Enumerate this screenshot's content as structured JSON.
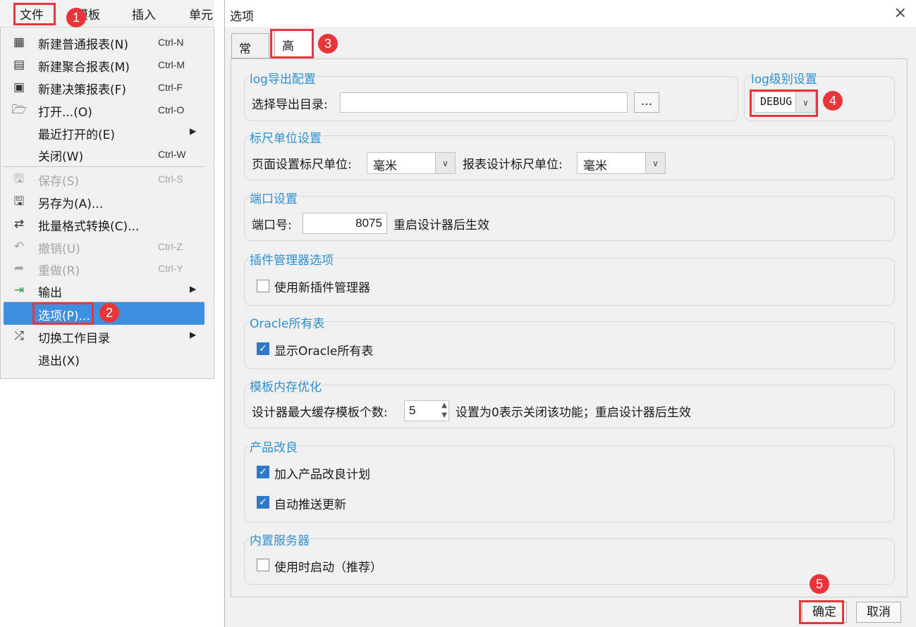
{
  "menubar": {
    "file": "文件",
    "template": "模板",
    "insert": "插入",
    "cell": "单元"
  },
  "menu": {
    "new_normal": {
      "label": "新建普通报表(N)",
      "shortcut": "Ctrl-N"
    },
    "new_aggregate": {
      "label": "新建聚合报表(M)",
      "shortcut": "Ctrl-M"
    },
    "new_decision": {
      "label": "新建决策报表(F)",
      "shortcut": "Ctrl-F"
    },
    "open": {
      "label": "打开...(O)",
      "shortcut": "Ctrl-O"
    },
    "recent": {
      "label": "最近打开的(E)"
    },
    "close": {
      "label": "关闭(W)",
      "shortcut": "Ctrl-W"
    },
    "save": {
      "label": "保存(S)",
      "shortcut": "Ctrl-S"
    },
    "save_as": {
      "label": "另存为(A)..."
    },
    "batch_convert": {
      "label": "批量格式转换(C)..."
    },
    "undo": {
      "label": "撤销(U)",
      "shortcut": "Ctrl-Z"
    },
    "redo": {
      "label": "重做(R)",
      "shortcut": "Ctrl-Y"
    },
    "export": {
      "label": "输出"
    },
    "options": {
      "label": "选项(P)..."
    },
    "switch_dir": {
      "label": "切换工作目录"
    },
    "exit": {
      "label": "退出(X)"
    }
  },
  "badges": [
    "1",
    "2",
    "3",
    "4",
    "5"
  ],
  "dialog": {
    "title": "选项",
    "close_icon": "×",
    "tabs": [
      "常用",
      "高级"
    ],
    "log_export": {
      "title": "log导出配置",
      "dir_label": "选择导出目录:",
      "dir_value": "",
      "browse": "..."
    },
    "log_level": {
      "title": "log级别设置",
      "value": "DEBUG"
    },
    "ruler": {
      "title": "标尺单位设置",
      "page_label": "页面设置标尺单位:",
      "page_value": "毫米",
      "design_label": "报表设计标尺单位:",
      "design_value": "毫米"
    },
    "port": {
      "title": "端口设置",
      "label": "端口号:",
      "value": "8075",
      "note": "重启设计器后生效"
    },
    "plugin": {
      "title": "插件管理器选项",
      "label": "使用新插件管理器",
      "checked": false
    },
    "oracle": {
      "title": "Oracle所有表",
      "label": "显示Oracle所有表",
      "checked": true
    },
    "cache": {
      "title": "模板内存优化",
      "label": "设计器最大缓存模板个数:",
      "value": "5",
      "note": "设置为0表示关闭该功能；重启设计器后生效"
    },
    "improve": {
      "title": "产品改良",
      "join_label": "加入产品改良计划",
      "join_checked": true,
      "auto_label": "自动推送更新",
      "auto_checked": true
    },
    "server": {
      "title": "内置服务器",
      "label": "使用时启动（推荐）",
      "checked": false
    },
    "ok": "确定",
    "cancel": "取消"
  }
}
